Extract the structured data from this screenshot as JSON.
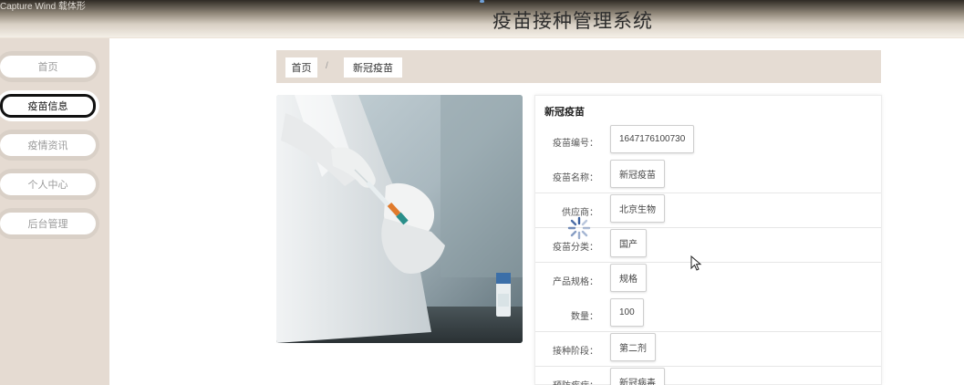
{
  "header": {
    "capture_text": "Capture Wind 载体形",
    "title": "疫苗接种管理系统"
  },
  "sidebar": {
    "items": [
      {
        "label": "首页",
        "active": false
      },
      {
        "label": "疫苗信息",
        "active": true
      },
      {
        "label": "疫情资讯",
        "active": false
      },
      {
        "label": "个人中心",
        "active": false
      },
      {
        "label": "后台管理",
        "active": false
      }
    ]
  },
  "breadcrumb": {
    "home": "首页",
    "separator": "/",
    "current": "新冠疫苗"
  },
  "detail": {
    "title": "新冠疫苗",
    "fields": [
      {
        "label": "疫苗编号：",
        "value": "1647176100730"
      },
      {
        "label": "疫苗名称：",
        "value": "新冠疫苗"
      },
      {
        "label": "供应商：",
        "value": "北京生物"
      },
      {
        "label": "疫苗分类：",
        "value": "国产"
      },
      {
        "label": "产品规格：",
        "value": "规格"
      },
      {
        "label": "数量：",
        "value": "100"
      },
      {
        "label": "接种阶段：",
        "value": "第二剂"
      },
      {
        "label": "预防疾病：",
        "value": "新冠病毒"
      }
    ]
  },
  "colors": {
    "sidebar_bg": "#e5dbd2",
    "breadcrumb_bg": "#e5dcd3",
    "active_border": "#111111"
  },
  "icons": [
    "loading-spinner-icon",
    "mouse-cursor-icon"
  ]
}
